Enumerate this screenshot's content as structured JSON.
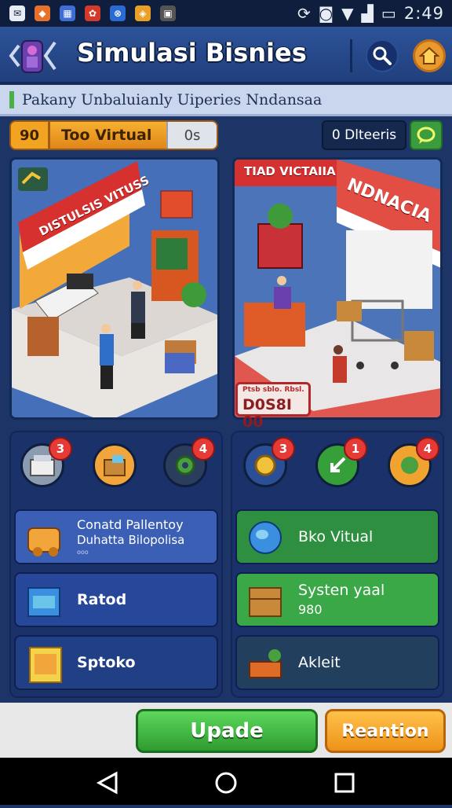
{
  "status_bar": {
    "time": "2:49",
    "left_icons": [
      "mail-icon",
      "firewall-icon",
      "calendar-icon",
      "game-icon",
      "maps-icon",
      "shield-icon",
      "box-icon"
    ],
    "right_icons": [
      "sync-icon",
      "camera-icon",
      "wifi-icon",
      "signal-icon",
      "battery-icon"
    ]
  },
  "header": {
    "title": "Simulasi Bisnies"
  },
  "subtitle": "Pakany Unbaluianly Uiperies Nndansaa",
  "toolbar": {
    "level": "90",
    "mode_label": "Too Virtual",
    "counter": "0s",
    "status_label": "0 Dlteeris"
  },
  "scenes": {
    "left_sign": "DISTULSIS VITUSS",
    "right_top_sign": "TIAD VICTAIIA",
    "right_store_sign": "NDNACIA",
    "price_small": "Ptsb sblo. Rbsl.",
    "price": "D0S8I 00"
  },
  "left_panel": {
    "badges": [
      "3",
      "4"
    ],
    "rows": [
      {
        "label": "Conatd Pallentoy",
        "sub": "Duhatta Bilopolisa",
        "tiny": "ooo"
      },
      {
        "label": "Ratod"
      },
      {
        "label": "Sptoko"
      }
    ]
  },
  "right_panel": {
    "badges": [
      "3",
      "1",
      "4"
    ],
    "rows": [
      {
        "label": "Bko Vitual"
      },
      {
        "label": "Systen yaal",
        "sub": "980"
      },
      {
        "label": "Akleit"
      }
    ]
  },
  "actions": {
    "primary": "Upade",
    "secondary": "Reantion"
  },
  "colors": {
    "header": "#2d5399",
    "accent_orange": "#f3a322",
    "accent_green": "#3a9c3e",
    "panel": "#1a3269"
  }
}
